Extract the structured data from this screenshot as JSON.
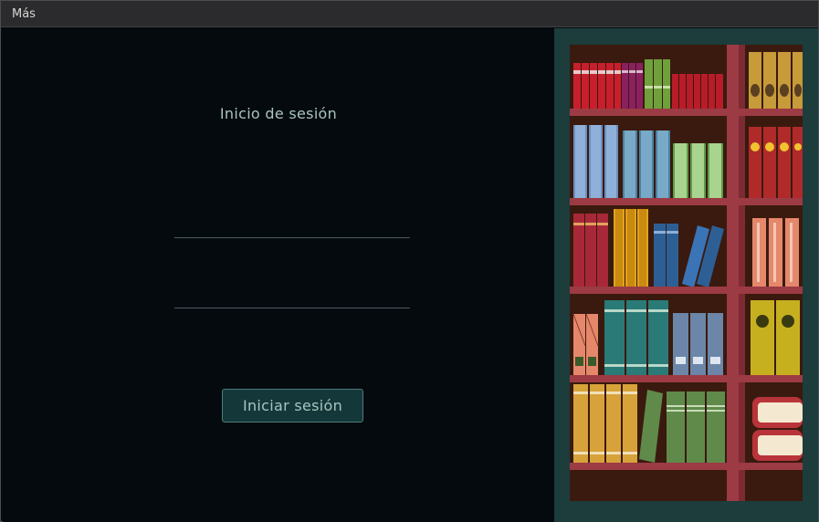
{
  "menubar": {
    "menu_mas": "Más"
  },
  "login": {
    "title": "Inicio de sesión",
    "username": {
      "value": "",
      "placeholder": ""
    },
    "password": {
      "value": "",
      "placeholder": ""
    },
    "button_label": "Iniciar sesión"
  },
  "colors": {
    "background": "#050a0e",
    "panel": "#1d3c3c",
    "accent_text": "#a9c4c0",
    "button_bg": "#14383a",
    "shelf_wood": "#9c3b44",
    "shelf_back": "#3a1a0e"
  },
  "illustration": {
    "subject": "bookshelf"
  }
}
